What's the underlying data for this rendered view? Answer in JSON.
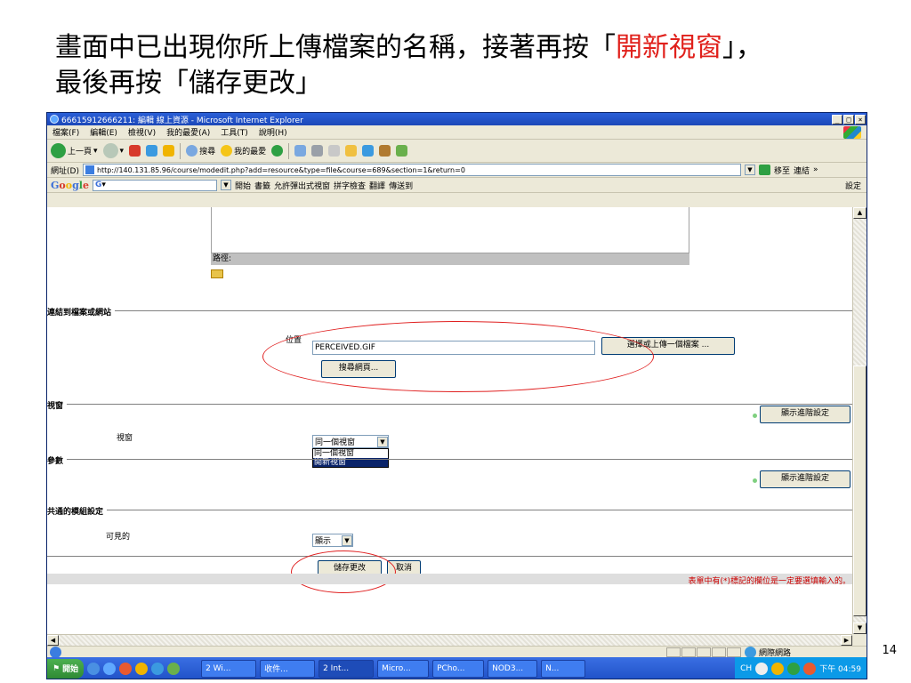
{
  "slide": {
    "title_part1": "畫面中已出現你所上傳檔案的名稱，接著再按「",
    "title_highlight": "開新視窗",
    "title_part2": "」，",
    "title_line2": "最後再按「儲存更改」",
    "page_number": "14"
  },
  "window": {
    "title": "66615912666211: 編輯 線上資源 - Microsoft Internet Explorer",
    "min": "_",
    "max": "□",
    "close": "×"
  },
  "menu": [
    "檔案(F)",
    "編輯(E)",
    "檢視(V)",
    "我的最愛(A)",
    "工具(T)",
    "說明(H)"
  ],
  "toolbar": {
    "back_label": "上一頁",
    "search_label": "搜尋",
    "favorites_label": "我的最愛"
  },
  "address": {
    "label": "網址(D)",
    "url": "http://140.131.85.96/course/modedit.php?add=resource&type=file&course=689&section=1&return=0",
    "go_label": "移至",
    "links_label": "連結"
  },
  "googlebar": {
    "logo": [
      "G",
      "o",
      "o",
      "g",
      "l",
      "e"
    ],
    "search_prefix": "G",
    "start": "開始",
    "bookmarks": "書籤",
    "popups": "允許彈出式視窗",
    "spell": "拼字檢查",
    "translate": "翻譯",
    "send": "傳送到",
    "settings": "設定"
  },
  "form": {
    "path_label": "路徑:",
    "link_section_title": "連結到檔案或網站",
    "location_label": "位置",
    "location_value": "PERCEIVED.GIF",
    "choose_upload_button": "選擇或上傳一個檔案 ...",
    "search_web_button": "搜尋網頁...",
    "window_section_title": "視窗",
    "show_advanced_1": "顯示進階設定",
    "window_label": "視窗",
    "window_select_value": "同一個視窗",
    "window_options": [
      "同一個視窗",
      "開新視窗"
    ],
    "params_section_title": "參數",
    "show_advanced_2": "顯示進階設定",
    "common_section_title": "共通的模組設定",
    "visible_label": "可見的",
    "visible_select_value": "顯示",
    "save_button": "儲存更改",
    "cancel_button": "取消",
    "required_note": "表單中有(*)標記的欄位是一定要選填輸入的。"
  },
  "status": {
    "zone": "網際網路"
  },
  "taskbar": {
    "start": "開始",
    "tasks": [
      "2 Wi...",
      "收件...",
      "2 Int...",
      "Micro...",
      "PCho...",
      "NOD3...",
      "N..."
    ],
    "ime": "CH",
    "clock": "下午 04:59"
  },
  "colors": {
    "title_highlight": "#e0201b",
    "annotation_oval": "#e02020",
    "required_note": "#cc0000",
    "taskbar": "#2152c8"
  }
}
